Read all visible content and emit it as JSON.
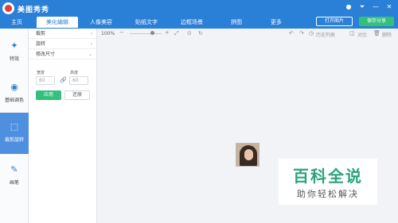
{
  "app": {
    "title": "美图秀秀"
  },
  "window_controls": [
    "●",
    "⏷",
    "—",
    "✕"
  ],
  "tabs": [
    {
      "label": "主页"
    },
    {
      "label": "美化编辑"
    },
    {
      "label": "人像美容"
    },
    {
      "label": "贴纸文字"
    },
    {
      "label": "边框场景"
    },
    {
      "label": "拼图"
    },
    {
      "label": "更多"
    }
  ],
  "header_buttons": {
    "open": "打开图片",
    "save": "保存分享"
  },
  "left_nav": [
    {
      "label": "特效",
      "icon": "✦"
    },
    {
      "label": "基础调色",
      "icon": "◉"
    },
    {
      "label": "裁剪旋转",
      "icon": "⬚"
    },
    {
      "label": "画笔",
      "icon": "✎"
    }
  ],
  "panel": {
    "rows": [
      {
        "label": "裁剪"
      },
      {
        "label": "旋转"
      },
      {
        "label": "修改尺寸"
      }
    ],
    "width_label": "宽度",
    "height_label": "高度",
    "width_value": "60",
    "height_value": "60",
    "apply": "应用",
    "restore": "还原"
  },
  "toolbar": {
    "zoom": "100%",
    "minus": "−",
    "plus": "+",
    "history": "历史列表",
    "compare": "对比",
    "delete": "删除"
  },
  "watermark": {
    "title": "百科全说",
    "subtitle": "助你轻松解决"
  }
}
